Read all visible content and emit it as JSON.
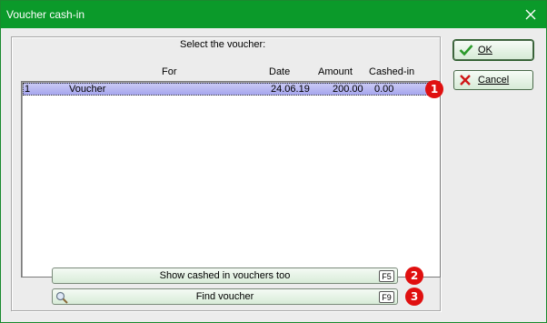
{
  "window": {
    "title": "Voucher cash-in"
  },
  "main": {
    "select_label": "Select the voucher:",
    "columns": {
      "for": "For",
      "date": "Date",
      "amount": "Amount",
      "cashed_in": "Cashed-in"
    },
    "rows": [
      {
        "num": "1",
        "for": "Voucher",
        "date": "24.06.19",
        "amount": "200.00",
        "cashed_in": "0.00"
      }
    ]
  },
  "buttons": {
    "show_cashed": {
      "label": "Show cashed in vouchers too",
      "key": "F5"
    },
    "find_voucher": {
      "label": "Find voucher",
      "key": "F9"
    },
    "ok": {
      "label": "OK"
    },
    "cancel": {
      "label": "Cancel"
    }
  },
  "badges": [
    "1",
    "2",
    "3"
  ],
  "colors": {
    "titlebar": "#0b9a2a",
    "selected_row": "#b0b0f0",
    "badge": "#e01010",
    "ok_check": "#2a9a2a",
    "cancel_x": "#d01818"
  },
  "icons": {
    "close": "close-icon",
    "ok": "checkmark-icon",
    "cancel": "x-icon",
    "find": "magnifier-icon"
  }
}
